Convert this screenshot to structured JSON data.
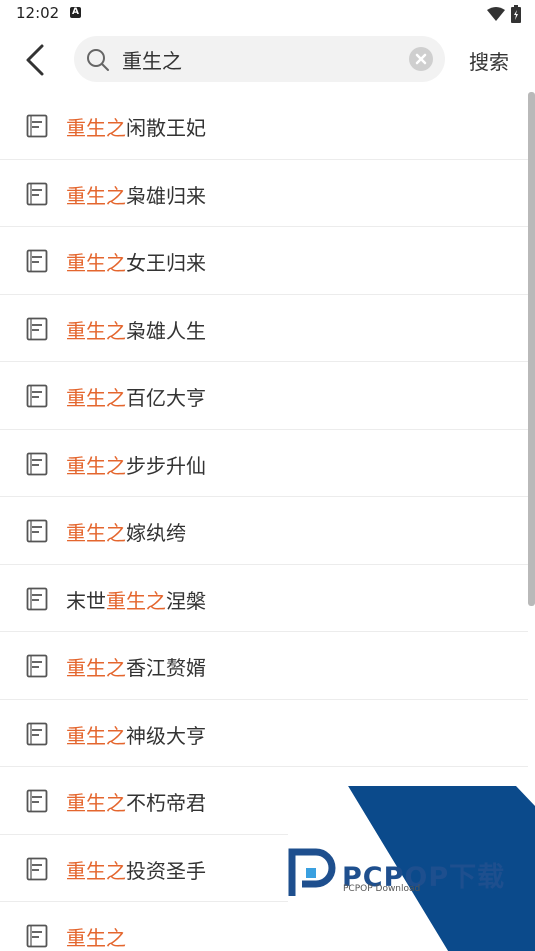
{
  "status": {
    "time": "12:02",
    "notification_letter": "A"
  },
  "search": {
    "query": "重生之",
    "button_label": "搜索"
  },
  "results": [
    {
      "before": "",
      "highlight": "重生之",
      "after": "闲散王妃"
    },
    {
      "before": "",
      "highlight": "重生之",
      "after": "枭雄归来"
    },
    {
      "before": "",
      "highlight": "重生之",
      "after": "女王归来"
    },
    {
      "before": "",
      "highlight": "重生之",
      "after": "枭雄人生"
    },
    {
      "before": "",
      "highlight": "重生之",
      "after": "百亿大亨"
    },
    {
      "before": "",
      "highlight": "重生之",
      "after": "步步升仙"
    },
    {
      "before": "",
      "highlight": "重生之",
      "after": "嫁纨绔"
    },
    {
      "before": "末世",
      "highlight": "重生之",
      "after": "涅槃"
    },
    {
      "before": "",
      "highlight": "重生之",
      "after": "香江赘婿"
    },
    {
      "before": "",
      "highlight": "重生之",
      "after": "神级大亨"
    },
    {
      "before": "",
      "highlight": "重生之",
      "after": "不朽帝君"
    },
    {
      "before": "",
      "highlight": "重生之",
      "after": "投资圣手"
    },
    {
      "before": "",
      "highlight": "重生之",
      "after": ""
    }
  ],
  "watermark": {
    "brand": "PCPOP下载",
    "sub": "PCPOP Download"
  },
  "colors": {
    "highlight": "#e4662e",
    "watermark_blue": "#1e4f8e"
  }
}
